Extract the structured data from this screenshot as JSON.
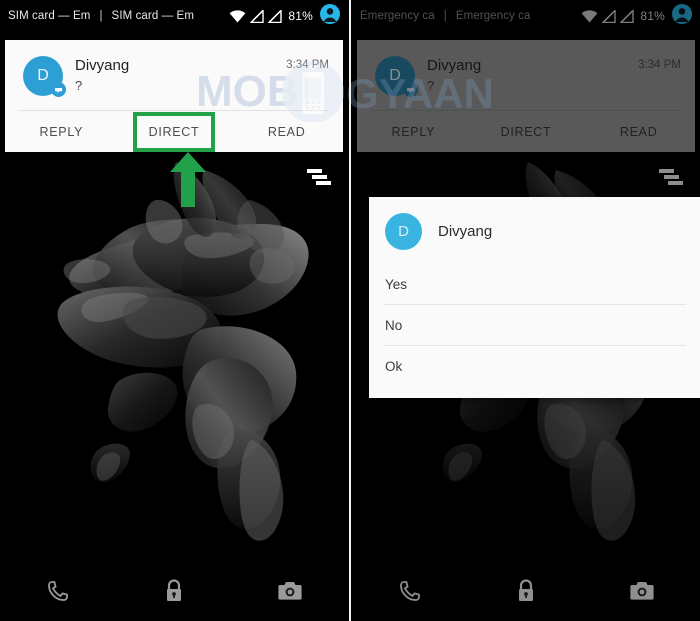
{
  "meta": {
    "accent_green": "#22a04a",
    "avatar_blue": "#39b3e0",
    "card_bg": "#fafafa"
  },
  "watermark": {
    "text_left": "MOBI",
    "text_right": "GYAAN"
  },
  "panels": [
    {
      "id": "left",
      "statusbar": {
        "carrier_1": "SIM card — Em",
        "separator": "|",
        "carrier_2": "SIM card — Em",
        "battery": "81%",
        "icons": [
          "wifi-icon",
          "no-sim-icon",
          "no-sim-icon",
          "user-account-icon"
        ]
      },
      "notification": {
        "avatar_letter": "D",
        "title": "Divyang",
        "body": "?",
        "time": "3:34 PM",
        "actions": [
          {
            "label": "REPLY",
            "highlighted": false
          },
          {
            "label": "DIRECT",
            "highlighted": true
          },
          {
            "label": "READ",
            "highlighted": false
          }
        ]
      },
      "callout": {
        "visible": true,
        "target": "DIRECT"
      },
      "shade_icon": "notification-list-icon",
      "dialog": null,
      "bottom_nav": [
        "phone-icon",
        "lock-icon",
        "camera-icon"
      ]
    },
    {
      "id": "right",
      "statusbar": {
        "carrier_1": "Emergency ca",
        "separator": "|",
        "carrier_2": "Emergency ca",
        "battery": "81%",
        "icons": [
          "wifi-icon",
          "no-sim-icon",
          "no-sim-icon",
          "user-account-icon"
        ]
      },
      "notification": {
        "avatar_letter": "D",
        "title": "Divyang",
        "body": "?",
        "time": "3:34 PM",
        "actions": [
          {
            "label": "REPLY",
            "highlighted": false
          },
          {
            "label": "DIRECT",
            "highlighted": false
          },
          {
            "label": "READ",
            "highlighted": false
          }
        ]
      },
      "callout": {
        "visible": false,
        "target": ""
      },
      "shade_icon": "notification-list-icon",
      "dialog": {
        "avatar_letter": "D",
        "title": "Divyang",
        "options": [
          "Yes",
          "No",
          "Ok"
        ]
      },
      "bottom_nav": [
        "phone-icon",
        "lock-icon",
        "camera-icon"
      ]
    }
  ]
}
